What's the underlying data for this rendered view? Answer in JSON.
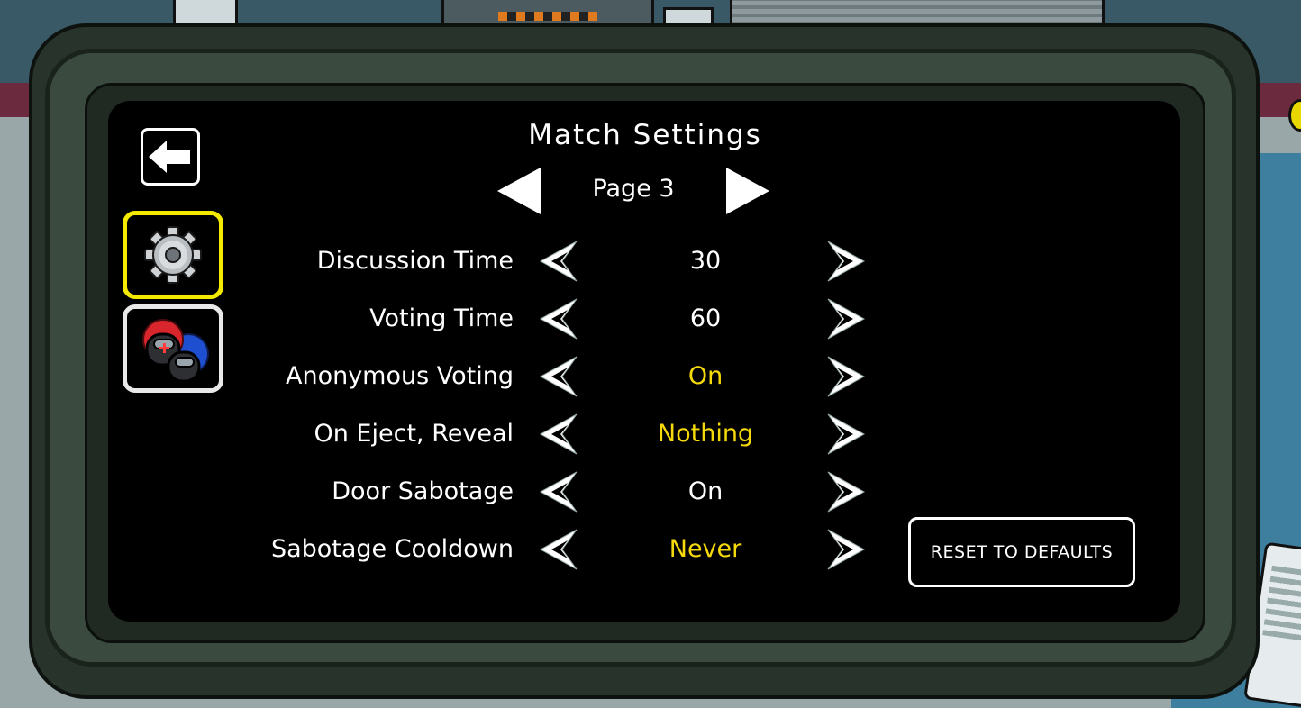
{
  "header": {
    "title": "Match Settings",
    "page_label": "Page 3"
  },
  "sidebar": {
    "tabs": [
      {
        "icon": "gear-icon",
        "selected": true,
        "border_color": "#f3ea00"
      },
      {
        "icon": "crewmate-roles-icon",
        "selected": false,
        "border_color": "#e9e9e9"
      }
    ]
  },
  "settings": [
    {
      "label": "Discussion Time",
      "value": "30",
      "value_color": "white"
    },
    {
      "label": "Voting Time",
      "value": "60",
      "value_color": "white"
    },
    {
      "label": "Anonymous Voting",
      "value": "On",
      "value_color": "yellow"
    },
    {
      "label": "On Eject, Reveal",
      "value": "Nothing",
      "value_color": "yellow"
    },
    {
      "label": "Door Sabotage",
      "value": "On",
      "value_color": "white"
    },
    {
      "label": "Sabotage Cooldown",
      "value": "Never",
      "value_color": "yellow"
    }
  ],
  "reset": {
    "label": "RESET TO DEFAULTS"
  },
  "colors": {
    "highlight_yellow": "#f5d90a",
    "frame_green": "#3b4a3f",
    "screen_black": "#000000"
  }
}
